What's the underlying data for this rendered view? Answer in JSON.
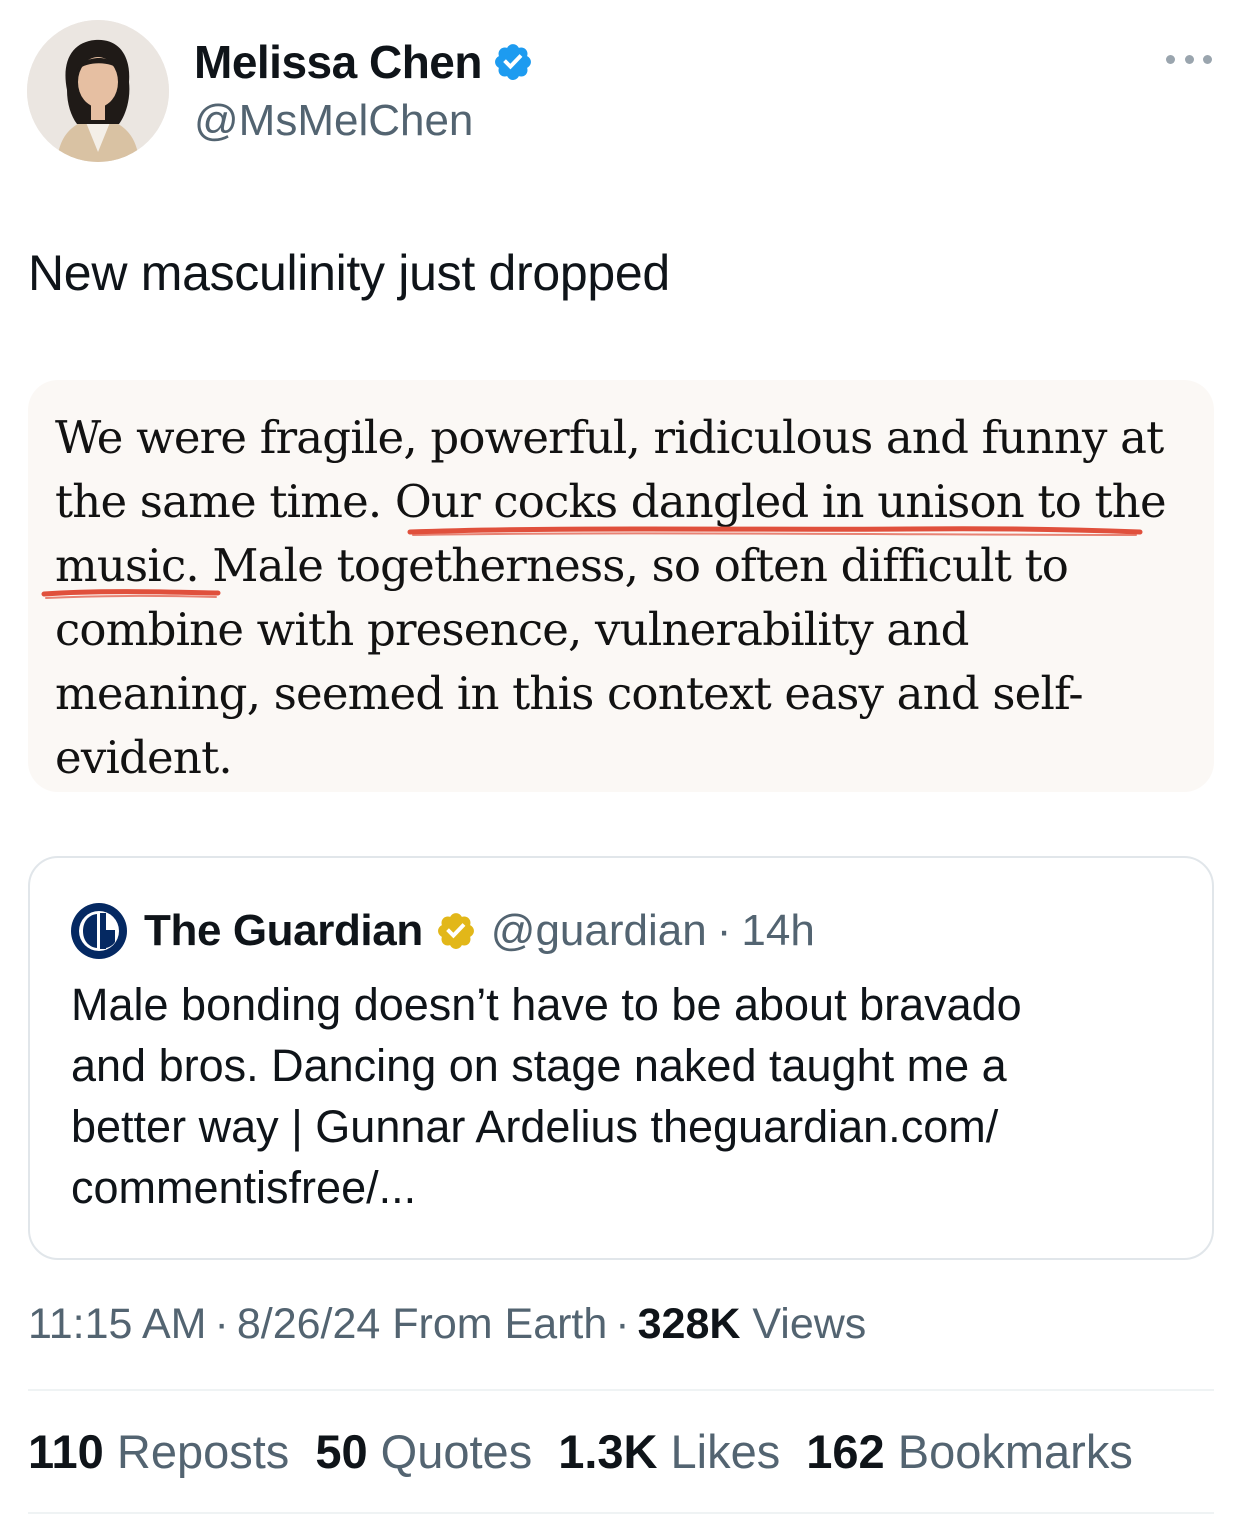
{
  "author": {
    "name": "Melissa Chen",
    "handle": "@MsMelChen",
    "avatar_icon": "avatar-photo",
    "verified_color": "#1d9bf0"
  },
  "tweet": {
    "text": "New masculinity just dropped"
  },
  "excerpt": {
    "lines": [
      "We were fragile, powerful, ridiculous and funny at",
      "the same time. Our cocks dangled in unison to the",
      "music. Male togetherness, so often difficult to",
      "combine with presence, vulnerability and",
      "meaning, seemed in this context easy and self-",
      "evident."
    ],
    "highlight_color": "#e0503c"
  },
  "quoted_tweet": {
    "name": "The Guardian",
    "handle": "@guardian",
    "dot": "·",
    "time": "14h",
    "verified_color": "#e2b719",
    "logo_icon": "guardian-logo",
    "lines": [
      "Male bonding doesn’t have to be about bravado",
      "and bros. Dancing on stage naked taught me a",
      "better way | Gunnar Ardelius theguardian.com/",
      "commentisfree/..."
    ]
  },
  "meta": {
    "time": "11:15 AM",
    "dot": "·",
    "date": "8/26/24",
    "source": "From Earth",
    "views_count": "328K",
    "views_label": "Views"
  },
  "stats": {
    "reposts_count": "110",
    "reposts_label": "Reposts",
    "quotes_count": "50",
    "quotes_label": "Quotes",
    "likes_count": "1.3K",
    "likes_label": "Likes",
    "bookmarks_count": "162",
    "bookmarks_label": "Bookmarks"
  }
}
